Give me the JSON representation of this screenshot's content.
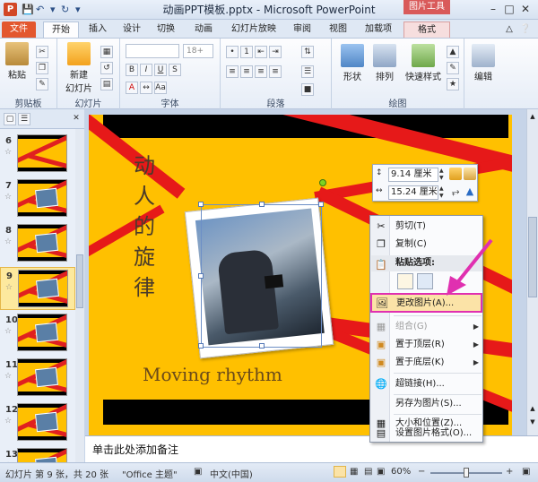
{
  "titlebar": {
    "app_icon": "P",
    "title": "动画PPT模板.pptx - Microsoft PowerPoint",
    "contextual_tool": "图片工具",
    "qat": {
      "save": "save-icon",
      "undo": "undo-icon",
      "redo": "redo-icon"
    }
  },
  "tabs": [
    "文件",
    "开始",
    "插入",
    "设计",
    "切换",
    "动画",
    "幻灯片放映",
    "审阅",
    "视图",
    "加载项",
    "格式"
  ],
  "ribbon": {
    "groups": {
      "clipboard": "剪贴板",
      "slides": "幻灯片",
      "font": "字体",
      "paragraph": "段落",
      "drawing": "绘图",
      "editing": ""
    },
    "buttons": {
      "paste": "粘贴",
      "new_slide_1": "新建",
      "new_slide_2": "幻灯片",
      "shapes": "形状",
      "arrange": "排列",
      "quick_styles": "快速样式",
      "edit": "编辑"
    },
    "font_size": "18+"
  },
  "thumbnails": [
    {
      "num": "6"
    },
    {
      "num": "7"
    },
    {
      "num": "8"
    },
    {
      "num": "9"
    },
    {
      "num": "10"
    },
    {
      "num": "11"
    },
    {
      "num": "12"
    },
    {
      "num": "13"
    }
  ],
  "slide": {
    "vertical_title": [
      "动",
      "人",
      "的",
      "旋",
      "律"
    ],
    "english_title": "Moving rhythm"
  },
  "notes_placeholder": "单击此处添加备注",
  "size_mini": {
    "height": "9.14 厘米",
    "width": "15.24 厘米"
  },
  "context_menu": {
    "cut": "剪切(T)",
    "copy": "复制(C)",
    "paste_header": "粘贴选项:",
    "change_picture": "更改图片(A)...",
    "group": "组合(G)",
    "bring_front": "置于顶层(R)",
    "send_back": "置于底层(K)",
    "hyperlink": "超链接(H)...",
    "save_as_picture": "另存为图片(S)...",
    "size_position": "大小和位置(Z)...",
    "format_picture": "设置图片格式(O)..."
  },
  "status": {
    "slide_info": "幻灯片 第 9 张，共 20 张",
    "theme": "\"Office 主题\"",
    "language": "中文(中国)",
    "zoom": "60%",
    "zoom_fraction": 0.6
  },
  "colors": {
    "slide_bg": "#ffc000",
    "stripe": "#e61919",
    "file_tab": "#e3572e",
    "highlight_border": "#e030b0"
  }
}
